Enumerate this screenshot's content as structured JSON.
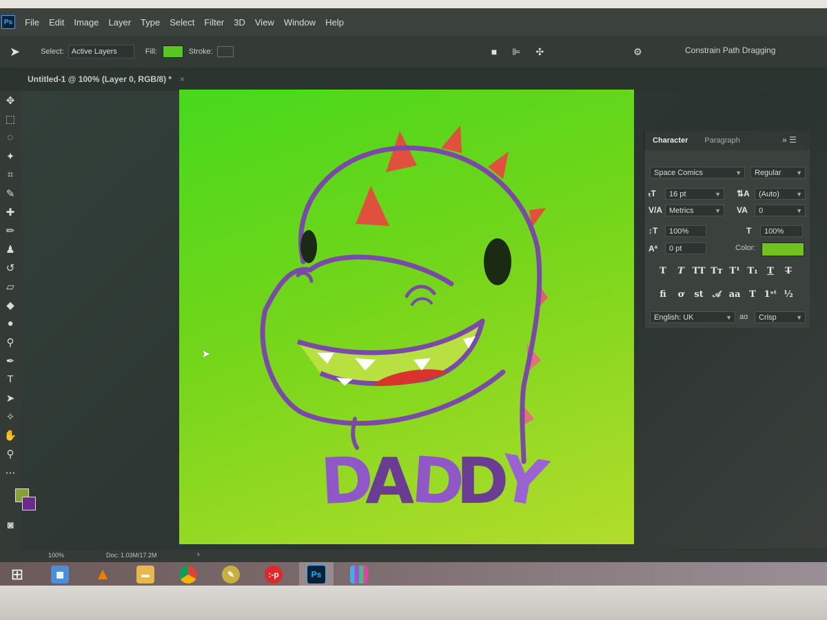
{
  "menubar": {
    "logo": "Ps",
    "items": [
      "File",
      "Edit",
      "Image",
      "Layer",
      "Type",
      "Select",
      "Filter",
      "3D",
      "View",
      "Window",
      "Help"
    ]
  },
  "options": {
    "select_label": "Select:",
    "select_value": "Active Layers",
    "fill_label": "Fill:",
    "fill_color": "#58c820",
    "stroke_label": "Stroke:",
    "constrain_label": "Constrain Path Dragging"
  },
  "document": {
    "tab_title": "Untitled-1 @ 100% (Layer 0, RGB/8) *",
    "close": "×"
  },
  "artwork": {
    "text": "DADDY",
    "colors": {
      "outline": "#7b4aa8",
      "spikes": "#e0503c",
      "letters": "#8f57c8",
      "letters_dark": "#6a3c94",
      "eye": "#1b2a12"
    }
  },
  "status": {
    "zoom": "100%",
    "doc_info": "Doc: 1.03M/17.2M",
    "arrow": "›"
  },
  "character_panel": {
    "tabs": [
      "Character",
      "Paragraph"
    ],
    "font_family": "Space Comics",
    "font_style": "Regular",
    "font_size": "16 pt",
    "leading": "(Auto)",
    "kerning": "Metrics",
    "tracking": "0",
    "vertical_scale": "100%",
    "horizontal_scale": "100%",
    "baseline_shift": "0 pt",
    "color_label": "Color:",
    "color": "#72c11f",
    "language": "English: UK",
    "aa_label": "aɑ",
    "antialias": "Crisp"
  },
  "taskbar": {
    "items": [
      "windows-start",
      "network",
      "vlc",
      "file-explorer",
      "chrome",
      "pencil-app",
      "quickpic",
      "photoshop",
      "bar-app"
    ],
    "ps_label": "Ps",
    "ap_label": ":-p"
  }
}
